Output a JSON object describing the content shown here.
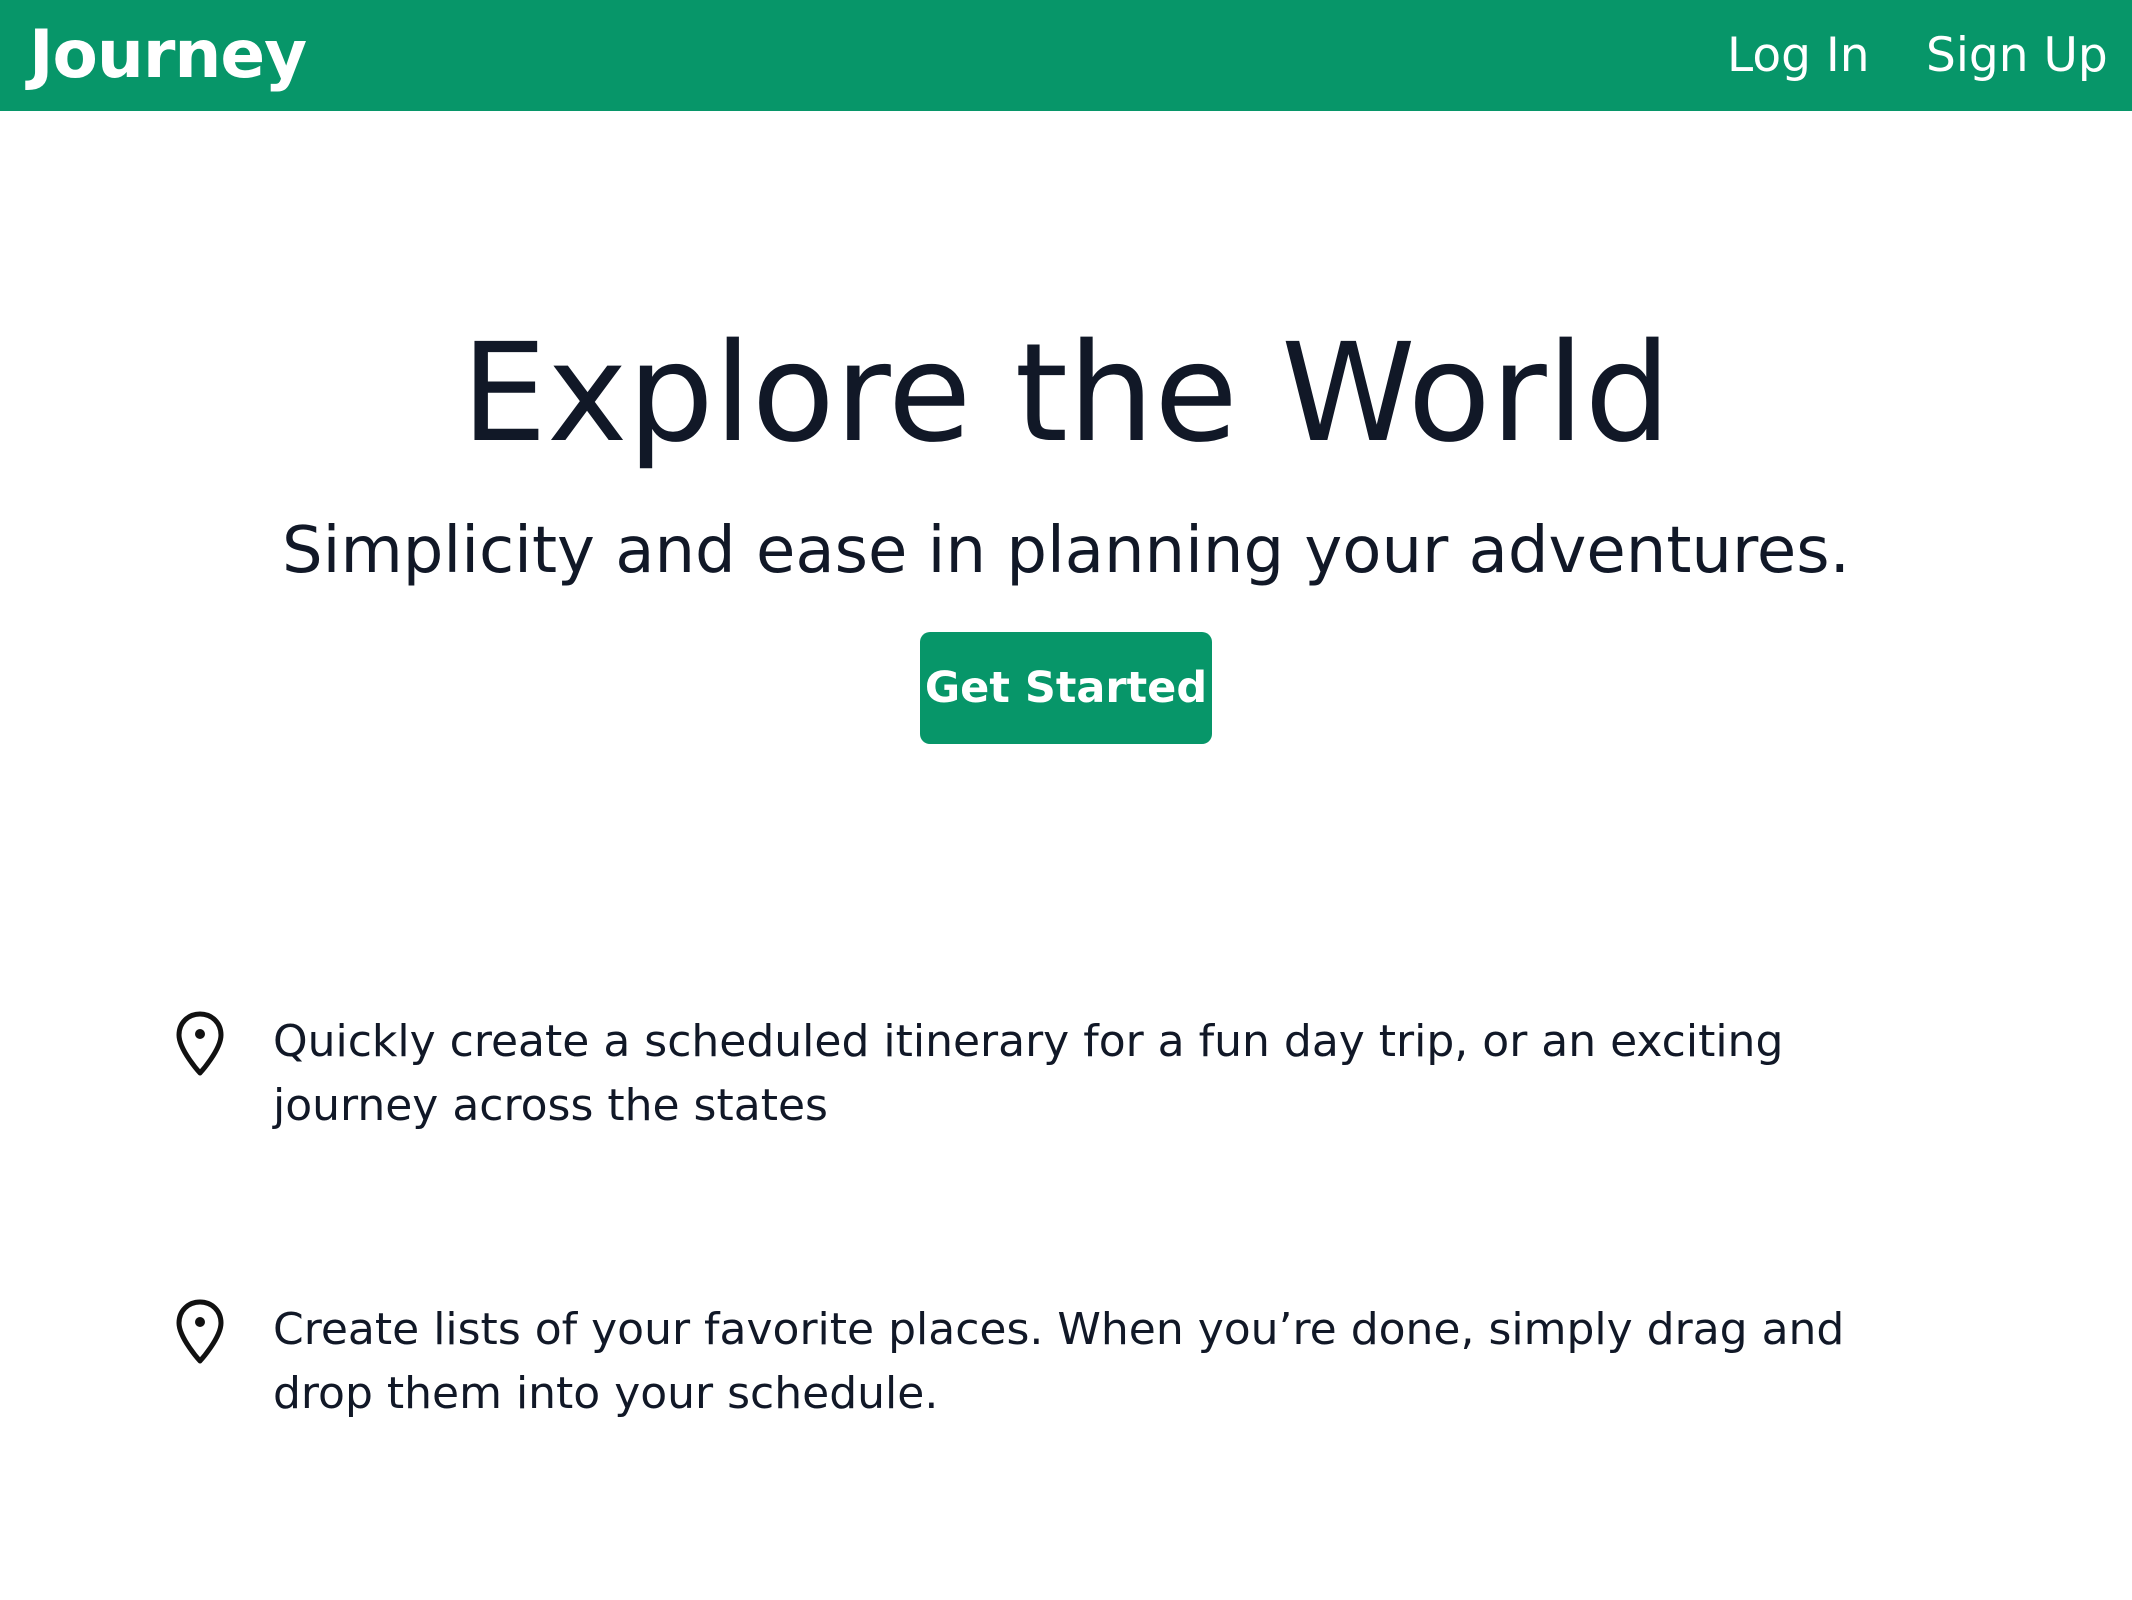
{
  "header": {
    "brand": "Journey",
    "login_label": "Log In",
    "signup_label": "Sign Up",
    "background_color": "#079669"
  },
  "hero": {
    "title": "Explore the World",
    "subtitle": "Simplicity and ease in planning your adventures.",
    "cta_label": "Get Started"
  },
  "features": [
    {
      "icon": "map-pin-icon",
      "text": "Quickly create a scheduled itinerary for a fun day trip, or an exciting journey across the states"
    },
    {
      "icon": "map-pin-icon",
      "text": "Create lists of your favorite places. When you’re done, simply drag and drop them into your schedule."
    }
  ]
}
